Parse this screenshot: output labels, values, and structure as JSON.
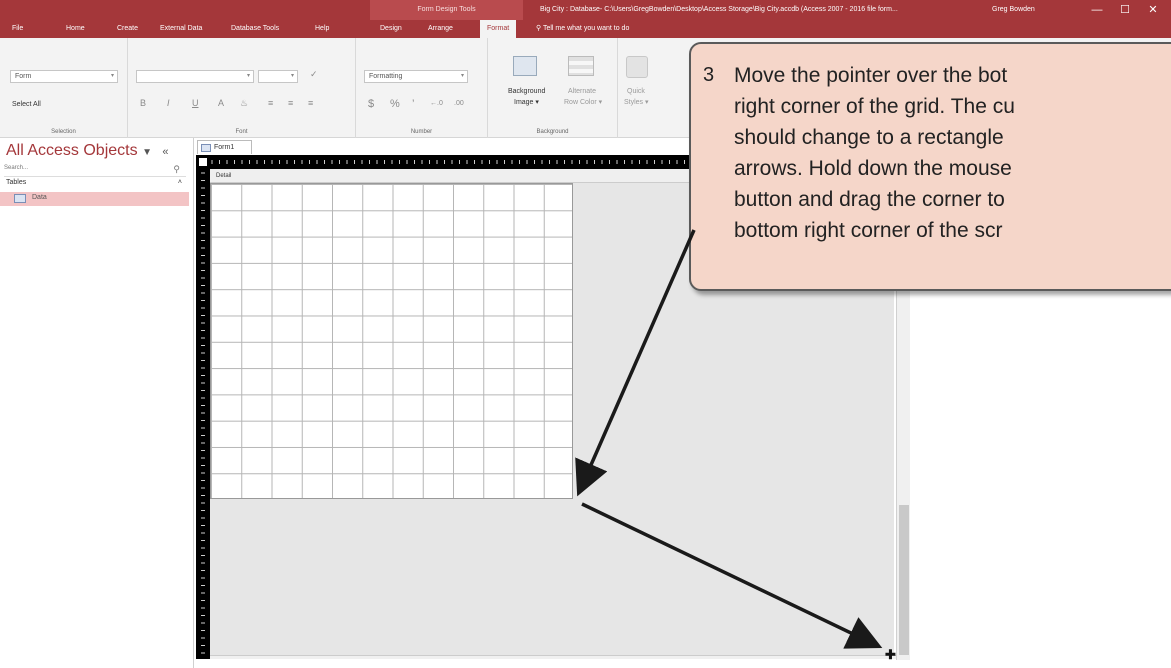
{
  "titlebar": {
    "context_group": "Form Design Tools",
    "document_title": "Big City : Database- C:\\Users\\GregBowden\\Desktop\\Access Storage\\Big City.accdb (Access 2007 - 2016 file form...",
    "user": "Greg Bowden",
    "minimize": "—",
    "restore": "☐",
    "close": "✕",
    "save_glyph": "💾",
    "undo_glyph": "↶",
    "redo_glyph": "↷"
  },
  "tabs": [
    "File",
    "Home",
    "Create",
    "External Data",
    "Database Tools",
    "Help",
    "Design",
    "Arrange",
    "Format"
  ],
  "active_tab": "Format",
  "tell_me": "Tell me what you want to do",
  "ribbon": {
    "selection": {
      "object_combo": "Form",
      "select_all": "Select All",
      "label": "Selection"
    },
    "font": {
      "bold": "B",
      "italic": "I",
      "underline": "U",
      "font_color": "A",
      "label": "Font"
    },
    "number": {
      "format_combo": "Formatting",
      "currency": "$",
      "percent": "%",
      "comma": "’",
      "inc_decimal": "←.0",
      "dec_decimal": ".00",
      "label": "Number"
    },
    "background": {
      "background_image": "Background",
      "background_image2": "Image ▾",
      "alternate_row": "Alternate",
      "alternate_row2": "Row Color ▾",
      "label": "Background"
    },
    "quick_styles": {
      "line1": "Quick",
      "line2": "Styles ▾"
    }
  },
  "nav": {
    "title": "All Access Objects",
    "search_placeholder": "Search...",
    "section": "Tables",
    "items": [
      {
        "label": "Data"
      }
    ]
  },
  "document": {
    "tab_label": "Form1",
    "section_label": "Detail"
  },
  "callout": {
    "number": "3",
    "lines": [
      "Move the pointer over the bot",
      "right corner of the grid.  The cu",
      "should change to a rectangle",
      "arrows.  Hold down the mouse",
      "button and drag the corner to",
      "bottom right corner of the scr"
    ]
  },
  "colors": {
    "accent": "#a4373a",
    "callout_fill": "#f5d6c9",
    "nav_selected": "#f3c4c5"
  }
}
